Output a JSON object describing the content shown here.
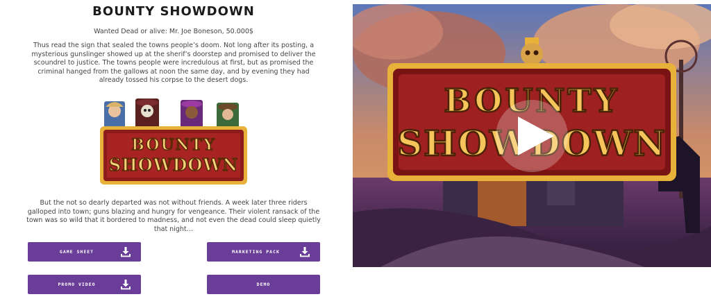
{
  "intro": {
    "title": "BOUNTY SHOWDOWN",
    "subtitle": "Wanted Dead or alive: Mr. Joe Boneson, 50.000$",
    "paragraph1": "Thus read the sign that sealed the towns people’s doom. Not long after its posting, a mysterious gunslinger showed up at the sherif’s doorstep and promised to deliver the scoundrel to justice. The towns people were incredulous at first, but as promised the criminal hanged from the gallows at noon the same day, and by evening they had already tossed his corpse to the desert dogs.",
    "paragraph2": "But the not so dearly departed was not without friends. A week later three riders galloped into town; guns blazing and hungry for vengeance. Their violent ransack of the town was so wild that it bordered to madness, and not even the dead could sleep quietly that night…"
  },
  "logo": {
    "line1": "BOUNTY",
    "line2": "SHOWDOWN"
  },
  "buttons": {
    "game_sheet": "GAME SHEET",
    "marketing_pack": "MARKETING PACK",
    "promo_video": "PROMO VIDEO",
    "demo": "DEMO"
  },
  "video": {
    "logo_line1": "BOUNTY",
    "logo_line2": "SHOWDOWN"
  },
  "colors": {
    "button_purple": "#6a3e98",
    "logo_red": "#8e1b1b",
    "logo_gold": "#e8b13a"
  },
  "icons": [
    "download-icon",
    "play-icon",
    "skull-icon"
  ]
}
